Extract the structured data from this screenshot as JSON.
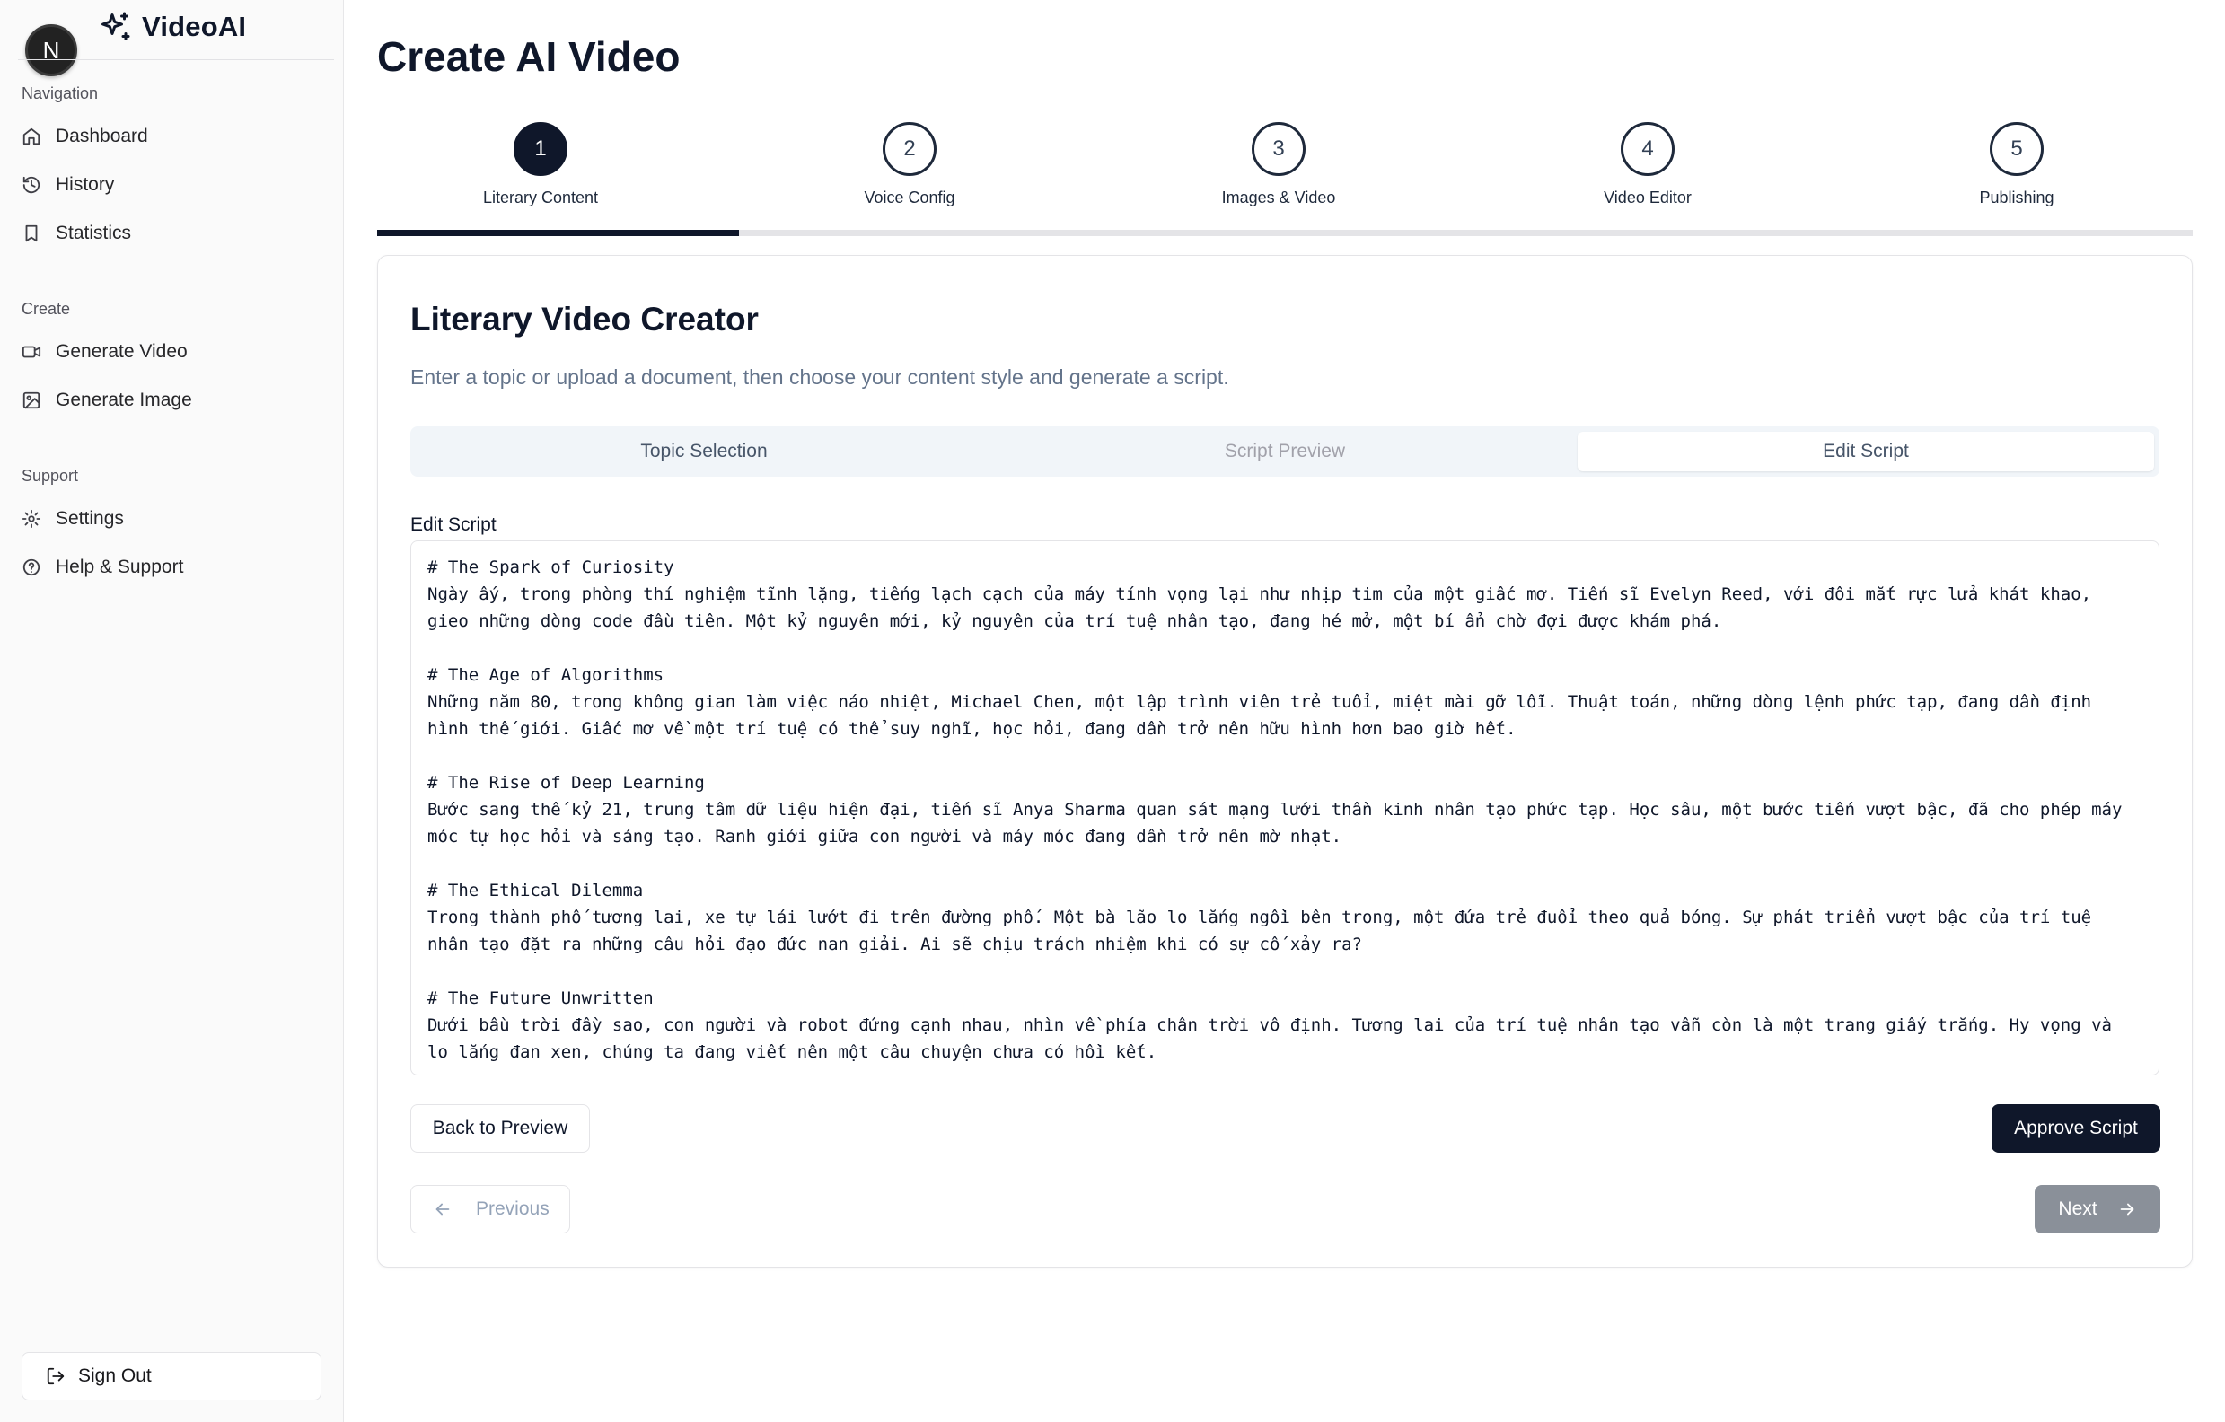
{
  "app": {
    "name": "VideoAI",
    "avatar_initial": "N"
  },
  "sidebar": {
    "sections": [
      {
        "title": "Navigation",
        "items": [
          {
            "label": "Dashboard",
            "icon": "home-icon"
          },
          {
            "label": "History",
            "icon": "history-icon"
          },
          {
            "label": "Statistics",
            "icon": "bookmark-icon"
          }
        ]
      },
      {
        "title": "Create",
        "items": [
          {
            "label": "Generate Video",
            "icon": "video-icon"
          },
          {
            "label": "Generate Image",
            "icon": "image-icon"
          }
        ]
      },
      {
        "title": "Support",
        "items": [
          {
            "label": "Settings",
            "icon": "gear-icon"
          },
          {
            "label": "Help & Support",
            "icon": "help-circle-icon"
          }
        ]
      }
    ],
    "sign_out": "Sign Out"
  },
  "page": {
    "title": "Create AI Video"
  },
  "stepper": {
    "current_step": 1,
    "steps": [
      {
        "number": "1",
        "label": "Literary Content"
      },
      {
        "number": "2",
        "label": "Voice Config"
      },
      {
        "number": "3",
        "label": "Images & Video"
      },
      {
        "number": "4",
        "label": "Video Editor"
      },
      {
        "number": "5",
        "label": "Publishing"
      }
    ]
  },
  "card": {
    "title": "Literary Video Creator",
    "subtitle": "Enter a topic or upload a document, then choose your content style and generate a script.",
    "tabs": [
      {
        "label": "Topic Selection",
        "state": "normal"
      },
      {
        "label": "Script Preview",
        "state": "disabled"
      },
      {
        "label": "Edit Script",
        "state": "selected"
      }
    ],
    "field_label": "Edit Script",
    "script_lines": [
      "# The Spark of Curiosity",
      "Ngày ấy, trong phòng thí nghiệm tĩnh lặng, tiếng lạch cạch của máy tính vọng lại như nhịp tim của một giấc mơ. Tiến sĩ Evelyn Reed, với đôi mắt rực lửa khát khao,",
      "gieo những dòng code đầu tiên. Một kỷ nguyên mới, kỷ nguyên của trí tuệ nhân tạo, đang hé mở, một bí ẩn chờ đợi được khám phá.",
      "",
      "# The Age of Algorithms",
      "Những năm 80, trong không gian làm việc náo nhiệt, Michael Chen, một lập trình viên trẻ tuổi, miệt mài gỡ lỗi. Thuật toán, những dòng lệnh phức tạp, đang dần định",
      "hình thế giới. Giấc mơ về một trí tuệ có thể suy nghĩ, học hỏi, đang dần trở nên hữu hình hơn bao giờ hết.",
      "",
      "# The Rise of Deep Learning",
      "Bước sang thế kỷ 21, trung tâm dữ liệu hiện đại, tiến sĩ Anya Sharma quan sát mạng lưới thần kinh nhân tạo phức tạp. Học sâu, một bước tiến vượt bậc, đã cho phép máy",
      "móc tự học hỏi và sáng tạo. Ranh giới giữa con người và máy móc đang dần trở nên mờ nhạt.",
      "",
      "# The Ethical Dilemma",
      "Trong thành phố tương lai, xe tự lái lướt đi trên đường phố. Một bà lão lo lắng ngồi bên trong, một đứa trẻ đuổi theo quả bóng. Sự phát triển vượt bậc của trí tuệ",
      "nhân tạo đặt ra những câu hỏi đạo đức nan giải. Ai sẽ chịu trách nhiệm khi có sự cố xảy ra?",
      "",
      "# The Future Unwritten",
      "Dưới bầu trời đầy sao, con người và robot đứng cạnh nhau, nhìn về phía chân trời vô định. Tương lai của trí tuệ nhân tạo vẫn còn là một trang giấy trắng. Hy vọng và",
      "lo lắng đan xen, chúng ta đang viết nên một câu chuyện chưa có hồi kết."
    ],
    "buttons": {
      "back": "Back to Preview",
      "approve": "Approve Script",
      "previous": "Previous",
      "next": "Next"
    }
  },
  "colors": {
    "primary": "#0f172a",
    "muted": "#64748b",
    "disabled_button": "#8a9099"
  }
}
